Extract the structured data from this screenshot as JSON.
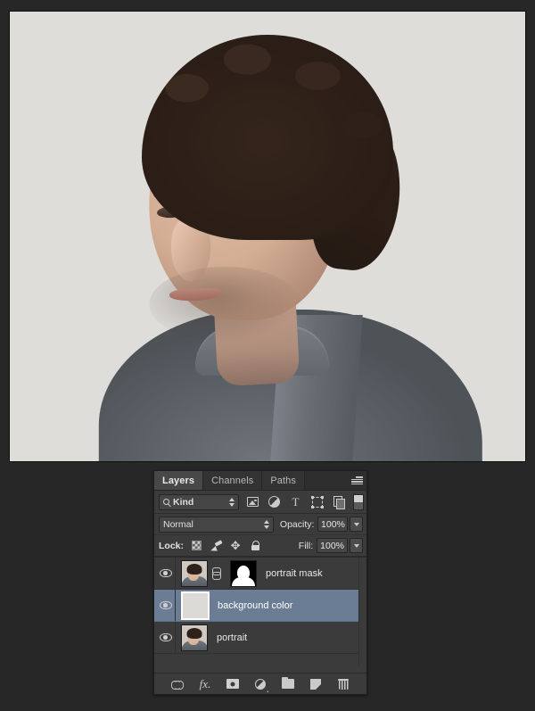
{
  "window": {
    "background_color": "#272727",
    "canvas_background": "#dedddb"
  },
  "canvas": {
    "name": "document-canvas",
    "description": "Portrait photograph of a man with dark curly hair wearing a grey mandarin-collar shirt on a light grey background"
  },
  "panel": {
    "title": "Layers",
    "menu_icon": "panel-menu-icon",
    "tabs": [
      {
        "label": "Layers",
        "active": true
      },
      {
        "label": "Channels",
        "active": false
      },
      {
        "label": "Paths",
        "active": false
      }
    ],
    "filter": {
      "kind_label": "Kind",
      "search_icon": "search-icon",
      "icons": [
        {
          "name": "filter-pixel-layers-icon"
        },
        {
          "name": "filter-adjustment-layers-icon"
        },
        {
          "name": "filter-type-layers-icon",
          "glyph": "T"
        },
        {
          "name": "filter-shape-layers-icon"
        },
        {
          "name": "filter-smart-object-icon"
        }
      ],
      "toggle_name": "filter-enable-toggle"
    },
    "blend": {
      "mode": "Normal",
      "opacity_label": "Opacity:",
      "opacity_value": "100%"
    },
    "lock": {
      "label": "Lock:",
      "icons": [
        {
          "name": "lock-transparent-pixels-icon"
        },
        {
          "name": "lock-image-pixels-icon"
        },
        {
          "name": "lock-position-icon"
        },
        {
          "name": "lock-all-icon"
        }
      ],
      "fill_label": "Fill:",
      "fill_value": "100%"
    },
    "layers": [
      {
        "name": "portrait mask",
        "visible": true,
        "selected": false,
        "has_mask": true,
        "linked": true,
        "thumb_type": "portrait"
      },
      {
        "name": "background color",
        "visible": true,
        "selected": true,
        "has_mask": false,
        "linked": false,
        "thumb_type": "solid"
      },
      {
        "name": "portrait",
        "visible": true,
        "selected": false,
        "has_mask": false,
        "linked": false,
        "thumb_type": "portrait"
      }
    ],
    "footer_buttons": [
      {
        "name": "link-layers-button"
      },
      {
        "name": "layer-style-fx-button",
        "label": "fx"
      },
      {
        "name": "add-layer-mask-button"
      },
      {
        "name": "new-adjustment-layer-button"
      },
      {
        "name": "new-group-button"
      },
      {
        "name": "new-layer-button"
      },
      {
        "name": "delete-layer-button"
      }
    ],
    "colors": {
      "panel_bg": "#3b3b3b",
      "selection": "#6b7d94",
      "text": "#e6e6e6",
      "tab_active": "#484848"
    }
  }
}
